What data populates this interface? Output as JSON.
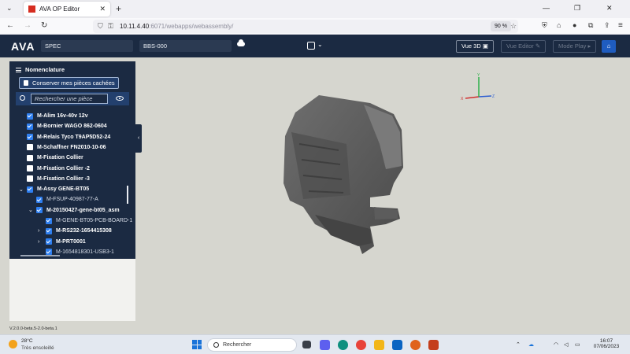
{
  "browser": {
    "tab_title": "AVA OP Editor",
    "url_host": "10.11.4.40",
    "url_rest": ":6071/webapps/webassembly/",
    "zoom": "90 %"
  },
  "app": {
    "logo": "AVA",
    "field1": "SPEC",
    "field2": "BBS-000",
    "vue3d": "Vue 3D",
    "vue_editor": "Vue Editor",
    "mode_play": "Mode Play"
  },
  "sidebar": {
    "title": "Nomenclature",
    "keep_button": "Conserver mes pièces cachées",
    "search_placeholder": "Rechercher une pièce",
    "items": [
      {
        "label": "M-Alim 16v-40v 12v",
        "checked": true,
        "bold": true,
        "level": 0
      },
      {
        "label": "M-Bornier WAGO 862-0604",
        "checked": true,
        "bold": true,
        "level": 0
      },
      {
        "label": "M-Relais Tyco T9AP5D52-24",
        "checked": true,
        "bold": true,
        "level": 0
      },
      {
        "label": "M-Schaffner FN2010-10-06",
        "checked": false,
        "bold": true,
        "level": 0
      },
      {
        "label": "M-Fixation Collier",
        "checked": false,
        "bold": true,
        "level": 0
      },
      {
        "label": "M-Fixation Collier -2",
        "checked": false,
        "bold": true,
        "level": 0
      },
      {
        "label": "M-Fixation Collier -3",
        "checked": false,
        "bold": true,
        "level": 0
      },
      {
        "label": "M-Assy GENE-BT05",
        "checked": true,
        "bold": true,
        "level": 0,
        "caret": "expanded"
      },
      {
        "label": "M-FSUP-40987-77-A",
        "checked": true,
        "bold": false,
        "level": 1
      },
      {
        "label": "M-20150427-gene-bt05_asm",
        "checked": true,
        "bold": true,
        "level": 1,
        "caret": "expanded"
      },
      {
        "label": "M-GENE-BT05-PCB-BOARD-1",
        "checked": true,
        "bold": false,
        "level": 2
      },
      {
        "label": "M-RS232-1654415308",
        "checked": true,
        "bold": true,
        "level": 2,
        "caret": "collapsed"
      },
      {
        "label": "M-PRT0001",
        "checked": true,
        "bold": true,
        "level": 2,
        "caret": "collapsed"
      },
      {
        "label": "M-1654818301-USB3-1",
        "checked": true,
        "bold": false,
        "level": 2
      }
    ]
  },
  "axes": {
    "x": "X",
    "y": "Y",
    "z": "Z"
  },
  "version": "V.2.0.0-beta.5-2.0-beta.1",
  "taskbar": {
    "temp": "28°C",
    "weather": "Très ensoleillé",
    "search": "Rechercher",
    "time": "16:07",
    "date": "07/06/2023"
  },
  "colors": {
    "navy": "#1b2a42",
    "accent_blue": "#2f7ff0",
    "viewport_bg": "#d6d6cf",
    "model_gray": "#5d5d5d"
  }
}
